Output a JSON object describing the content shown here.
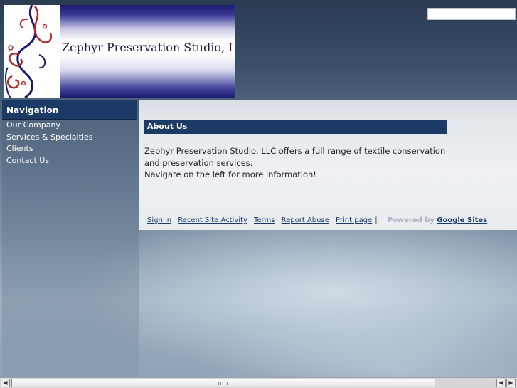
{
  "header": {
    "site_title": "Zephyr Preservation Studio, LLC",
    "search": {
      "placeholder": "",
      "value": ""
    }
  },
  "sidebar": {
    "heading": "Navigation",
    "items": [
      {
        "label": "Our Company"
      },
      {
        "label": "Services & Specialties"
      },
      {
        "label": "Clients"
      },
      {
        "label": "Contact Us"
      }
    ]
  },
  "main": {
    "heading": "About Us",
    "body": [
      "Zephyr Preservation Studio, LLC offers a full range of textile conservation and preservation services.",
      "Navigate on the left for more information!"
    ]
  },
  "footer": {
    "links": [
      "Sign in",
      "Recent Site Activity",
      "Terms",
      "Report Abuse",
      "Print page"
    ],
    "separator": "|",
    "powered_by": "Powered by",
    "brand": "Google Sites"
  },
  "colors": {
    "header_bar": "#1b3b66",
    "banner_red": "#b02a2a",
    "banner_navy": "#1a1a6e"
  },
  "scrollbar": {
    "left_arrow_icon": "arrow-left-icon",
    "right_arrow_icon": "arrow-right-icon"
  }
}
